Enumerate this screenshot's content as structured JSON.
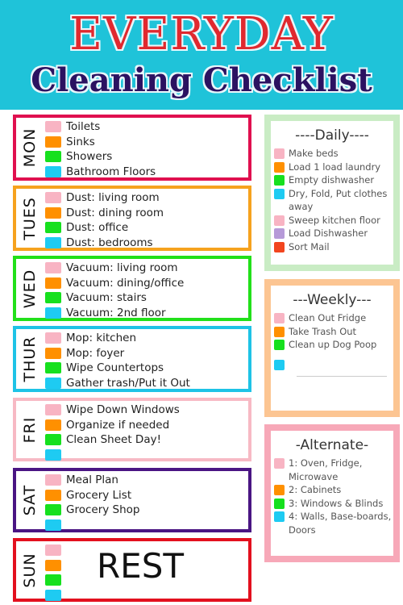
{
  "header": {
    "title_line1": "EVERYDAY",
    "title_line2": "Cleaning Checklist",
    "background_color": "#1fc3d9"
  },
  "swatch_colors": {
    "pink": "#f8b4c3",
    "orange": "#ff9000",
    "green": "#16e01e",
    "blue": "#1ecbf2",
    "purple": "#b69ad8",
    "red": "#f2451e"
  },
  "days": [
    {
      "label": "MON",
      "border_color": "#e0104f",
      "tasks": [
        "Toilets",
        "Sinks",
        "Showers",
        "Bathroom Floors"
      ]
    },
    {
      "label": "TUES",
      "border_color": "#f6a21e",
      "tasks": [
        "Dust: living room",
        "Dust: dining room",
        "Dust: office",
        "Dust: bedrooms"
      ]
    },
    {
      "label": "WED",
      "border_color": "#22e01a",
      "tasks": [
        "Vacuum: living room",
        "Vacuum: dining/office",
        "Vacuum: stairs",
        "Vacuum: 2nd floor"
      ]
    },
    {
      "label": "THUR",
      "border_color": "#1ec3e6",
      "tasks": [
        "Mop: kitchen",
        "Mop: foyer",
        "Wipe Countertops",
        "Gather trash/Put it Out"
      ]
    },
    {
      "label": "FRI",
      "border_color": "#f7b9c4",
      "tasks": [
        "Wipe Down Windows",
        "Organize if needed",
        "Clean Sheet Day!",
        ""
      ]
    },
    {
      "label": "SAT",
      "border_color": "#4a1583",
      "tasks": [
        "Meal Plan",
        "Grocery List",
        "Grocery Shop",
        ""
      ]
    },
    {
      "label": "SUN",
      "border_color": "#e3101e",
      "tasks": [
        "",
        "",
        "",
        ""
      ],
      "note": "REST"
    }
  ],
  "daily": {
    "title": "----Daily----",
    "border_color": "#c9ecc4",
    "items": [
      {
        "color": "pink",
        "text": "Make beds"
      },
      {
        "color": "orange",
        "text": "Load 1 load laundry"
      },
      {
        "color": "green",
        "text": "Empty dishwasher"
      },
      {
        "color": "blue",
        "text": "Dry, Fold, Put clothes away"
      },
      {
        "color": "pink",
        "text": "Sweep kitchen floor"
      },
      {
        "color": "purple",
        "text": "Load Dishwasher"
      },
      {
        "color": "red",
        "text": "Sort Mail"
      }
    ]
  },
  "weekly": {
    "title": "---Weekly---",
    "border_color": "#fcc592",
    "items": [
      {
        "color": "pink",
        "text": "Clean Out Fridge"
      },
      {
        "color": "orange",
        "text": "Take Trash Out"
      },
      {
        "color": "green",
        "text": "Clean up Dog Poop"
      },
      {
        "color": "blue",
        "text": ""
      }
    ]
  },
  "alternate": {
    "title": "-Alternate-",
    "border_color": "#f7a8b8",
    "items": [
      {
        "color": "pink",
        "text": "1: Oven, Fridge, Microwave"
      },
      {
        "color": "orange",
        "text": "2: Cabinets"
      },
      {
        "color": "green",
        "text": "3: Windows & Blinds"
      },
      {
        "color": "blue",
        "text": "4: Walls, Base-boards, Doors"
      }
    ]
  }
}
